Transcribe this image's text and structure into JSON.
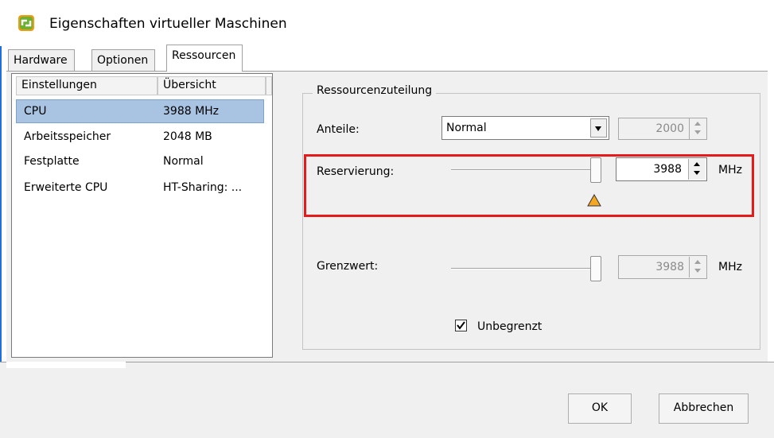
{
  "window": {
    "title": "Eigenschaften virtueller Maschinen",
    "icon": "vsphere-vm-icon"
  },
  "tabs": [
    {
      "label": "Hardware",
      "active": false
    },
    {
      "label": "Optionen",
      "active": false
    },
    {
      "label": "Ressourcen",
      "active": true
    }
  ],
  "list": {
    "headers": [
      "Einstellungen",
      "Übersicht"
    ],
    "rows": [
      {
        "name": "CPU",
        "value": "3988 MHz",
        "selected": true
      },
      {
        "name": "Arbeitsspeicher",
        "value": "2048 MB",
        "selected": false
      },
      {
        "name": "Festplatte",
        "value": "Normal",
        "selected": false
      },
      {
        "name": "Erweiterte CPU",
        "value": "HT-Sharing: ...",
        "selected": false
      }
    ]
  },
  "allocation": {
    "group_title": "Ressourcenzuteilung",
    "shares": {
      "label": "Anteile:",
      "selected": "Normal",
      "value": "2000"
    },
    "reservation": {
      "label": "Reservierung:",
      "value": "3988",
      "unit": "MHz",
      "level": 1.0,
      "warning": true
    },
    "limit": {
      "label": "Grenzwert:",
      "value": "3988",
      "unit": "MHz",
      "level": 1.0
    },
    "unlimited": {
      "label": "Unbegrenzt",
      "checked": true
    }
  },
  "buttons": {
    "ok": "OK",
    "cancel": "Abbrechen"
  },
  "colors": {
    "highlight": "#e51b1b",
    "selection": "#a8c4e2",
    "warning": "#f5a623"
  }
}
